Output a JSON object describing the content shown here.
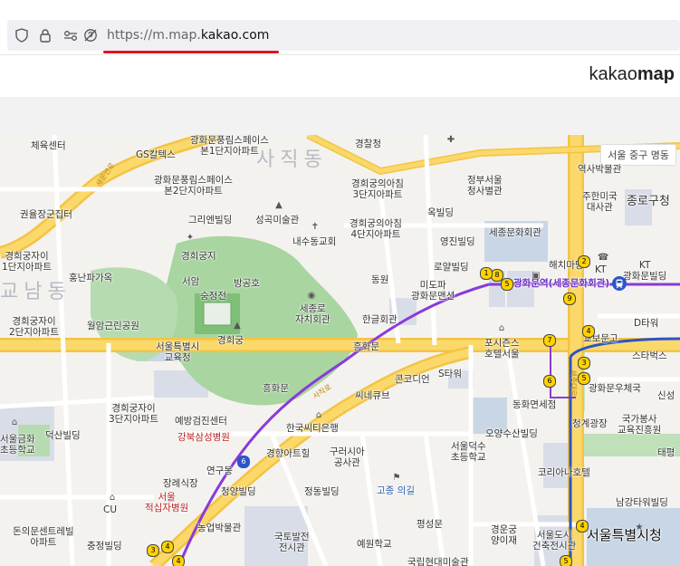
{
  "browser": {
    "url_scheme": "https://",
    "url_subdomain": "m.map.",
    "url_host": "kakao.com"
  },
  "header": {
    "brand_light": "kakao",
    "brand_bold": "map"
  },
  "map": {
    "location_tag": "서울 중구 명동",
    "districts": [
      "사직동",
      "교남동"
    ],
    "roads": {
      "saemunan": "새문안로",
      "sajik": "사직로",
      "sejong": "세종대로"
    },
    "labels": {
      "gs": "GS칼텍스",
      "bookhan": "광화문풍림스페이스\n본1단지아파트",
      "gyeongchal": "경찰청",
      "gyeonghui_top": "경희궁의아침\n3단지아파트",
      "jeongbu": "정부서울\n청사별관",
      "yeoksa": "역사박물관",
      "juhan": "주한미국\n대사관",
      "jongno": "종로구청",
      "cheyuk": "체육센터",
      "punglim2": "광화문풍림스페이스\n본2단지아파트",
      "kwonyul": "권율장군집터",
      "grien": "그리엔빌딩",
      "seonggok": "성곡미술관",
      "okbil": "옥빌딩",
      "naesu": "내수동교회",
      "gyeonghui_4": "경희궁의아침\n4단지아파트",
      "yeongjin": "영진빌딩",
      "sejong_culture": "세종문화회관",
      "gyeonghui_5": "경희궁자이\n1단지아파트",
      "gyeonghuigung_small": "경희궁지",
      "seoam": "서암",
      "bangongho": "방공호",
      "dongwon": "동원",
      "romal": "로얄빌딩",
      "haechi": "해치마당",
      "kt_top": "KT",
      "kt_office": "KT\n광화문빌딩",
      "sungjeong": "숭정전",
      "mido": "미도파\n광화문맨션",
      "hongnan": "홍난파가옥",
      "gyeonghui_2": "경희궁자이\n2단지아파트",
      "sejongro": "세종로\n자치회관",
      "gwanghwamun_station": "광화문역(세종문화회관)",
      "gyeonghuigung": "경희궁",
      "hangul": "한글회관",
      "gyobo": "교보문고",
      "dtower": "D타워",
      "wolam": "월암근린공원",
      "seoulmuseum": "서울특별시\n교육청",
      "heungkuk": "흥화문",
      "fourseasons": "포시즌스\n호텔서울",
      "starbucks": "스타벅스",
      "kongkodi": "콘코디언",
      "stower": "S타워",
      "heunghwamun": "흥화문",
      "ssine": "씨네큐브",
      "kyobo_post": "광화문우체국",
      "sinseong": "신성",
      "dongwha": "동화면세점",
      "cheonggye": "청계광장",
      "gyeonghui_3": "경희궁자이\n3단지아파트",
      "yebang": "예방검진센터",
      "hanguk_citi": "한국씨티은행",
      "osan": "오양수산빌딩",
      "gukga": "국가봉사\n교육진흥원",
      "geumhwa": "서울금화\n초등학교",
      "deoksan": "덕산빌딩",
      "kangbuk": "강북삼성병원",
      "gyeonghyang": "경향아트힐",
      "gurisia": "구러시아\n공사관",
      "deoksu_school": "서울덕수\n초등학교",
      "korea_hotel": "코리아나호텔",
      "taepyeong": "태평",
      "yeonguso": "연구동",
      "jangdae": "장례식장",
      "seoul_red": "서울\n적십자병원",
      "cheongyang": "청양빌딩",
      "jeongdong": "정동빌딩",
      "godeung": "고종 의길",
      "namgang": "남강타워빌딩",
      "cu": "CU",
      "nongeop": "농업박물관",
      "pyeongsan": "평성문",
      "gyeongun": "경운궁\n양이재",
      "seouldo": "서울도시\n건축전시관",
      "seoul_cityhall": "서울특별시청",
      "donui": "돈의문센트레빌\n아파트",
      "chungjeong": "충정빌딩",
      "guktobalchun": "국토발전\n전시관",
      "yewon": "예원학교",
      "gukrip": "국립현대미술관"
    },
    "exits": [
      "8",
      "1",
      "2",
      "9",
      "4",
      "3",
      "5",
      "7",
      "6",
      "5",
      "4",
      "3",
      "4",
      "5",
      "4"
    ],
    "line_numbers": [
      "5",
      "6"
    ]
  }
}
